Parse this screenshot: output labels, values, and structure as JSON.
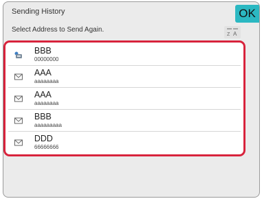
{
  "header": {
    "title": "Sending History",
    "ok_label": "OK",
    "instruction": "Select Address to Send Again.",
    "sort_icon": "sort-az-icon"
  },
  "colors": {
    "accent": "#2bb8c2",
    "highlight_frame": "#d8233c",
    "icon_blue": "#3d7fc4"
  },
  "history": {
    "items": [
      {
        "name": "BBB",
        "address": "00000000",
        "icon": "fax-icon"
      },
      {
        "name": "AAA",
        "address": "aaaaaaaa",
        "icon": "email-icon"
      },
      {
        "name": "AAA",
        "address": "aaaaaaaa",
        "icon": "email-icon"
      },
      {
        "name": "BBB",
        "address": "aaaaaaaaa",
        "icon": "email-icon"
      },
      {
        "name": "DDD",
        "address": "66666666",
        "icon": "email-icon"
      }
    ]
  }
}
